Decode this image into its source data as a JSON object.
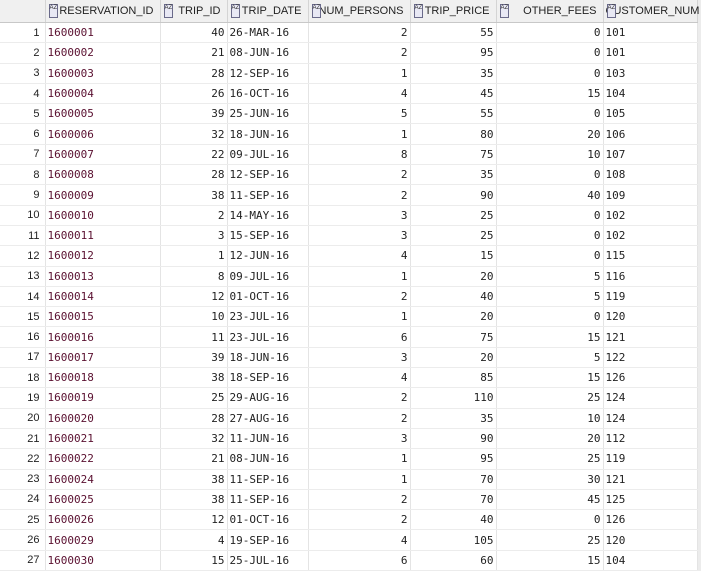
{
  "columns": [
    "RESERVATION_ID",
    "TRIP_ID",
    "TRIP_DATE",
    "NUM_PERSONS",
    "TRIP_PRICE",
    "OTHER_FEES",
    "CUSTOMER_NUM"
  ],
  "rows": [
    [
      "1",
      "1600001",
      "40",
      "26-MAR-16",
      "2",
      "55",
      "0",
      "101"
    ],
    [
      "2",
      "1600002",
      "21",
      "08-JUN-16",
      "2",
      "95",
      "0",
      "101"
    ],
    [
      "3",
      "1600003",
      "28",
      "12-SEP-16",
      "1",
      "35",
      "0",
      "103"
    ],
    [
      "4",
      "1600004",
      "26",
      "16-OCT-16",
      "4",
      "45",
      "15",
      "104"
    ],
    [
      "5",
      "1600005",
      "39",
      "25-JUN-16",
      "5",
      "55",
      "0",
      "105"
    ],
    [
      "6",
      "1600006",
      "32",
      "18-JUN-16",
      "1",
      "80",
      "20",
      "106"
    ],
    [
      "7",
      "1600007",
      "22",
      "09-JUL-16",
      "8",
      "75",
      "10",
      "107"
    ],
    [
      "8",
      "1600008",
      "28",
      "12-SEP-16",
      "2",
      "35",
      "0",
      "108"
    ],
    [
      "9",
      "1600009",
      "38",
      "11-SEP-16",
      "2",
      "90",
      "40",
      "109"
    ],
    [
      "10",
      "1600010",
      "2",
      "14-MAY-16",
      "3",
      "25",
      "0",
      "102"
    ],
    [
      "11",
      "1600011",
      "3",
      "15-SEP-16",
      "3",
      "25",
      "0",
      "102"
    ],
    [
      "12",
      "1600012",
      "1",
      "12-JUN-16",
      "4",
      "15",
      "0",
      "115"
    ],
    [
      "13",
      "1600013",
      "8",
      "09-JUL-16",
      "1",
      "20",
      "5",
      "116"
    ],
    [
      "14",
      "1600014",
      "12",
      "01-OCT-16",
      "2",
      "40",
      "5",
      "119"
    ],
    [
      "15",
      "1600015",
      "10",
      "23-JUL-16",
      "1",
      "20",
      "0",
      "120"
    ],
    [
      "16",
      "1600016",
      "11",
      "23-JUL-16",
      "6",
      "75",
      "15",
      "121"
    ],
    [
      "17",
      "1600017",
      "39",
      "18-JUN-16",
      "3",
      "20",
      "5",
      "122"
    ],
    [
      "18",
      "1600018",
      "38",
      "18-SEP-16",
      "4",
      "85",
      "15",
      "126"
    ],
    [
      "19",
      "1600019",
      "25",
      "29-AUG-16",
      "2",
      "110",
      "25",
      "124"
    ],
    [
      "20",
      "1600020",
      "28",
      "27-AUG-16",
      "2",
      "35",
      "10",
      "124"
    ],
    [
      "21",
      "1600021",
      "32",
      "11-JUN-16",
      "3",
      "90",
      "20",
      "112"
    ],
    [
      "22",
      "1600022",
      "21",
      "08-JUN-16",
      "1",
      "95",
      "25",
      "119"
    ],
    [
      "23",
      "1600024",
      "38",
      "11-SEP-16",
      "1",
      "70",
      "30",
      "121"
    ],
    [
      "24",
      "1600025",
      "38",
      "11-SEP-16",
      "2",
      "70",
      "45",
      "125"
    ],
    [
      "25",
      "1600026",
      "12",
      "01-OCT-16",
      "2",
      "40",
      "0",
      "126"
    ],
    [
      "26",
      "1600029",
      "4",
      "19-SEP-16",
      "4",
      "105",
      "25",
      "120"
    ],
    [
      "27",
      "1600030",
      "15",
      "25-JUL-16",
      "6",
      "60",
      "15",
      "104"
    ]
  ]
}
